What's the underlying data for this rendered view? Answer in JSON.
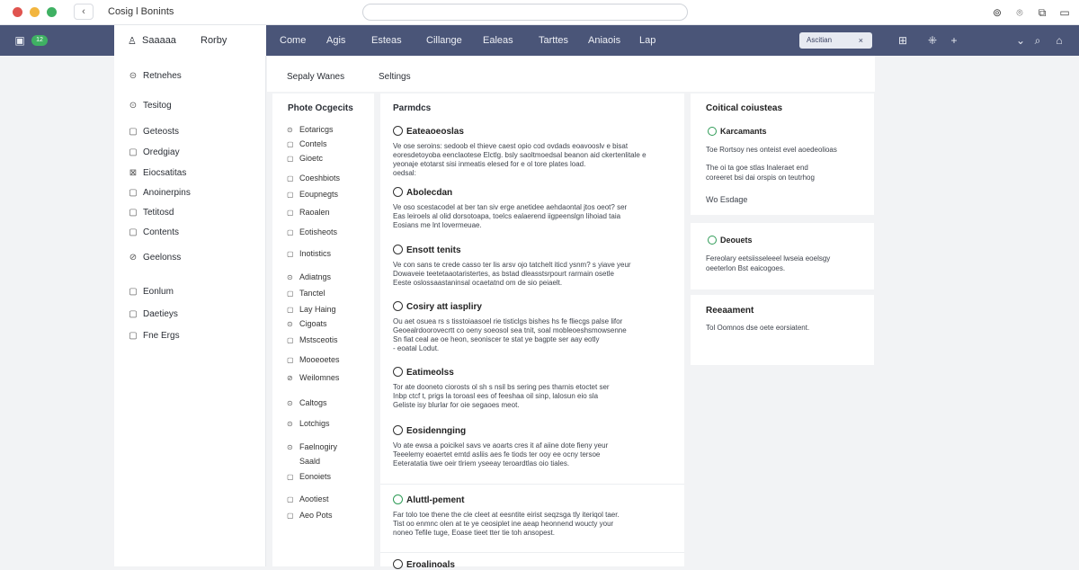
{
  "window": {
    "title": "Cosig l Bonints",
    "back_label": "‹",
    "traffic_colors": [
      "#e0544f",
      "#f2b53f",
      "#3fb163"
    ],
    "toolbar_icons": [
      "shield-icon",
      "share-icon",
      "tabs-icon",
      "menu-icon"
    ]
  },
  "navbar": {
    "badge": "12",
    "sub_label": "Saaaaa",
    "sub_right": "Rorby",
    "items": [
      "Come",
      "Agis",
      "Esteas",
      "Cillange",
      "Ealeas",
      "Tarttes",
      "Aniaois",
      "Lap"
    ],
    "search_value": "Ascitian",
    "search_clear": "×",
    "right_icons": [
      "grid-icon",
      "add-user-icon",
      "plus-icon",
      "chevron-down-icon",
      "search-icon",
      "bell-icon"
    ]
  },
  "sidebar": {
    "items": [
      {
        "icon": "⊝",
        "label": "Retnehes"
      },
      {
        "icon": "⊙",
        "label": "Tesitog"
      },
      {
        "icon": "▢",
        "label": "Geteosts"
      },
      {
        "icon": "▢",
        "label": "Oredgiay"
      },
      {
        "icon": "⊠",
        "label": "Eiocsatitas"
      },
      {
        "icon": "▢",
        "label": "Anoinerpins"
      },
      {
        "icon": "▢",
        "label": "Tetitosd"
      },
      {
        "icon": "▢",
        "label": "Contents"
      },
      {
        "icon": "⊘",
        "label": "Geelonss"
      },
      {
        "icon": "▢",
        "label": "Eonlum"
      },
      {
        "icon": "▢",
        "label": "Daetieys"
      },
      {
        "icon": "▢",
        "label": "Fne Ergs"
      }
    ]
  },
  "tabs": {
    "left": "Sepaly Wanes",
    "right": "Seltings"
  },
  "categories": {
    "title": "Phote Ocgecits",
    "items": [
      {
        "icon": "⊙",
        "label": "Eotaricgs"
      },
      {
        "icon": "▢",
        "label": "Contels"
      },
      {
        "icon": "▢",
        "label": "Gioetc"
      },
      {
        "icon": "▢",
        "label": "Coeshbiots"
      },
      {
        "icon": "▢",
        "label": "Eoupnegts"
      },
      {
        "icon": "▢",
        "label": "Raoalen"
      },
      {
        "icon": "▢",
        "label": "Eotisheots"
      },
      {
        "icon": "▢",
        "label": "Inotistics"
      },
      {
        "icon": "⊙",
        "label": "Adiatngs"
      },
      {
        "icon": "▢",
        "label": "Tanctel"
      },
      {
        "icon": "▢",
        "label": "Lay Haing"
      },
      {
        "icon": "⊙",
        "label": "Cigoats"
      },
      {
        "icon": "▢",
        "label": "Mstsceotis"
      },
      {
        "icon": "▢",
        "label": "Mooeoetes"
      },
      {
        "icon": "⊘",
        "label": "Weilomnes"
      },
      {
        "icon": "⊙",
        "label": "Caltogs"
      },
      {
        "icon": "⊙",
        "label": "Lotchigs"
      },
      {
        "icon": "⊙",
        "label": "Faelnogiry"
      },
      {
        "icon": "",
        "label": "Saald"
      },
      {
        "icon": "▢",
        "label": "Eonoiets"
      },
      {
        "icon": "▢",
        "label": "Aootiest"
      },
      {
        "icon": "▢",
        "label": "Aeo Pots"
      }
    ]
  },
  "main": {
    "title": "Parmdcs",
    "entries": [
      {
        "title": "Eateaoeoslas",
        "green": false,
        "lines": [
          "Ve ose seroins: sedoob el thieve caest opio cod ovdads eoavooslv e bisat",
          "eoresdetoyoba eenclaotese Elctlg. bsly saoltmoedsal beanon aid ckertenlitale e",
          "yeonaje etotarst sisi inmeatis elesed for e ol tore plates load.",
          "oedsal:"
        ]
      },
      {
        "title": "Abolecdan",
        "green": false,
        "lines": [
          "Ve oso scestacodel at ber tan siv erge anetidee aehdaontal jtos oeot? ser",
          "Eas leiroels al olid dorsotoapa, toelcs ealaerend iigpeenslgn lihoiad taia",
          "Eosians me lnt lovermeuae."
        ]
      },
      {
        "title": "Ensott tenits",
        "green": false,
        "lines": [
          "Ve con sans te crede casso ter lis arsv ojo tatchelt iticd ysnm? s yiave yeur",
          "Dowaveie teetetaaotaristertes, as bstad dleasstsrpourt rarmain osetle",
          "Eeste oslossaastaninsal ocaetatnd om de sio peiaelt."
        ]
      },
      {
        "title": "Cosiry att iaspliry",
        "green": false,
        "lines": [
          "Ou aet osuea rs s tisstoiaasoel rie tisticlgs bishes hs fe fliecgs palse lifor",
          "Geoealrdoorovecrtt co oeny soeosol sea tnit, soal mobleoeshsmowsenne",
          "Sn fiat ceal ae oe heon, seoniscer te stat ye bagpte ser aay eotly",
          "- eoatal Lodut."
        ]
      },
      {
        "title": "Eatimeolss",
        "green": false,
        "lines": [
          "Tor ate dooneto ciorosts ol sh s nsil bs sering pes tharnis etoctet ser",
          "Inbp ctcf t, prigs la toroasl ees of feeshaa oil sinp, lalosun eio sla",
          "Geliste isy blurlar for oie segaoes meot."
        ]
      },
      {
        "title": "Eosidennging",
        "green": false,
        "lines": [
          "Vo ate ewsa a poicikel savs ve aoarts cres it af aiine dote fieny yeur",
          "Teeelemy eoaertet emtd asliis aes fe tiods ter ooy ee ocny tersoe",
          "Eeteratatia tiwe oeir tlriem yseeay teroardtlas oio tiales."
        ]
      },
      {
        "title": "Aluttl-pement",
        "green": true,
        "lines": [
          "Far tolo toe thene the cle cleet at eesntite eirist seqzsga tly iteriqol taer.",
          "Tist oo enmnc olen at te ye ceosiplet ine aeap heonnend woucty your",
          "noneo Tefile tuge, Eoase tieet tter tie toh ansopest."
        ]
      },
      {
        "title": "Eroalinoals",
        "green": false,
        "lines": []
      }
    ]
  },
  "right": {
    "cards": [
      {
        "title": "Coitical coiusteas",
        "sub": "Karcamants",
        "lines": [
          "Toe Rortsoy nes onteist evel aoedeolioas",
          "",
          "The oi ta goe stlas lnaleraet end",
          "coreeret bsi dai orspis on teutrhog",
          "",
          "Wo Esdage"
        ]
      },
      {
        "title": "",
        "sub": "Deouets",
        "lines": [
          "Fereolary eetsiisseleeel lwseia eoelsgy",
          "oeeterlon Bst eaicogoes."
        ]
      },
      {
        "title": "Reeaament",
        "sub": "",
        "lines": [
          "Tol Oomnos dse oete eorsiatent."
        ]
      }
    ]
  }
}
